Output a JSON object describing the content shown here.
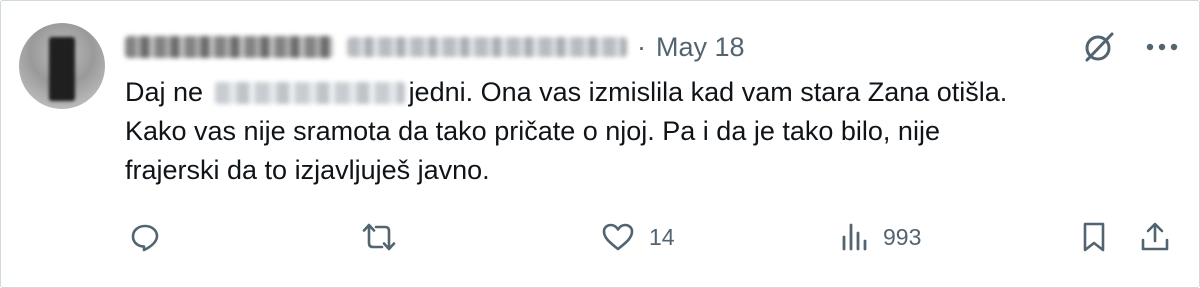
{
  "tweet": {
    "author_name": "",
    "author_handle": "",
    "separator": "·",
    "date": "May 18",
    "text_before_censor": "Daj ne ",
    "text_after_censor": "jedni. Ona vas izmislila kad vam stara Zana otišla.",
    "line2": "Kako vas nije sramota da tako pričate o njoj. Pa i da je tako bilo, nije",
    "line3": "frajerski da to izjavljuješ javno."
  },
  "header_icons": [
    "grok-icon",
    "more-icon"
  ],
  "actions": {
    "reply": {
      "icon": "reply-icon",
      "count": ""
    },
    "repost": {
      "icon": "repost-icon",
      "count": ""
    },
    "like": {
      "icon": "heart-icon",
      "count": "14"
    },
    "views": {
      "icon": "analytics-icon",
      "count": "993"
    },
    "bookmark": {
      "icon": "bookmark-icon"
    },
    "share": {
      "icon": "share-icon"
    }
  },
  "colors": {
    "text": "#0f1419",
    "secondary": "#536471",
    "border": "#cfd9de"
  }
}
